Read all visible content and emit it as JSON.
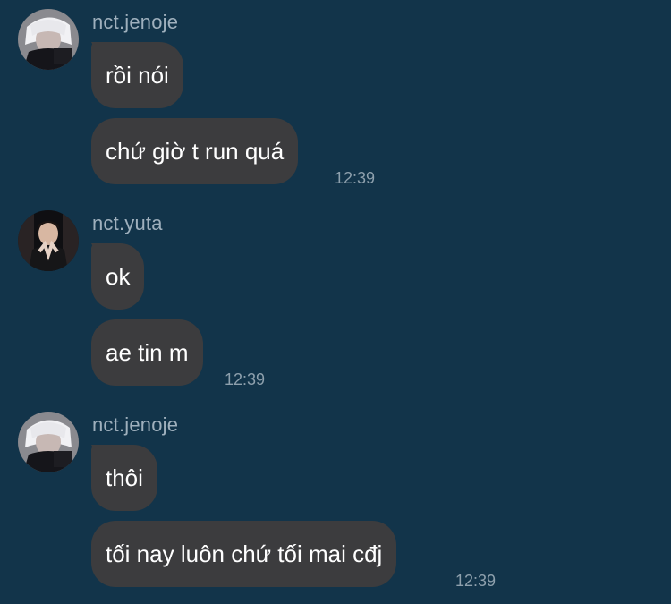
{
  "theme": {
    "background": "#12344a",
    "bubble": "#3c3c3e",
    "bubble_text": "#ffffff",
    "username": "#9fb0bd",
    "timestamp": "#8ea0ad"
  },
  "groups": [
    {
      "username": "nct.jenoje",
      "avatar": "user-avatar-photo",
      "messages": [
        "rồi nói",
        "chứ giờ t run quá"
      ],
      "time": "12:39"
    },
    {
      "username": "nct.yuta",
      "avatar": "user-avatar-photo",
      "messages": [
        "ok",
        "ae tin m"
      ],
      "time": "12:39"
    },
    {
      "username": "nct.jenoje",
      "avatar": "user-avatar-photo",
      "messages": [
        "thôi",
        "tối nay luôn chứ tối mai cđj"
      ],
      "time": "12:39"
    }
  ]
}
